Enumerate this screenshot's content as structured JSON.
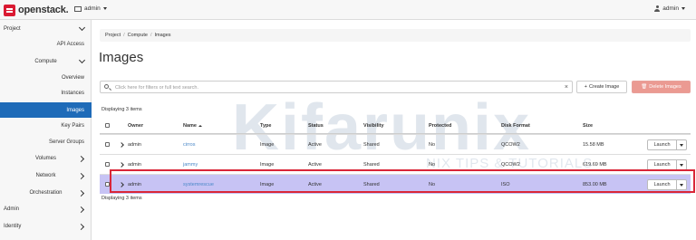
{
  "topbar": {
    "logo_text": "openstack.",
    "project_label": "admin",
    "user_label": "admin"
  },
  "sidebar": {
    "items": [
      {
        "label": "Project",
        "level": 0,
        "chevron": "down"
      },
      {
        "label": "API Access",
        "level": 2
      },
      {
        "label": "Compute",
        "level": 1,
        "chevron": "down"
      },
      {
        "label": "Overview",
        "level": 2
      },
      {
        "label": "Instances",
        "level": 2
      },
      {
        "label": "Images",
        "level": 2,
        "active": true
      },
      {
        "label": "Key Pairs",
        "level": 2
      },
      {
        "label": "Server Groups",
        "level": 2
      },
      {
        "label": "Volumes",
        "level": 1,
        "chevron": "right"
      },
      {
        "label": "Network",
        "level": 1,
        "chevron": "right"
      },
      {
        "label": "Orchestration",
        "level": 1,
        "chevron": "right"
      },
      {
        "label": "Admin",
        "level": 0,
        "chevron": "right"
      },
      {
        "label": "Identity",
        "level": 0,
        "chevron": "right"
      }
    ]
  },
  "breadcrumb": [
    "Project",
    "Compute",
    "Images"
  ],
  "page_title": "Images",
  "search": {
    "placeholder": "Click here for filters or full text search.",
    "value": "",
    "clear": "×"
  },
  "actions": {
    "create_label": "Create Image",
    "delete_label": "Delete Images"
  },
  "displaying_top": "Displaying 3 items",
  "displaying_bottom": "Displaying 3 items",
  "table": {
    "headers": {
      "owner": "Owner",
      "name": "Name",
      "type": "Type",
      "status": "Status",
      "visibility": "Visibility",
      "protected": "Protected",
      "disk_format": "Disk Format",
      "size": "Size"
    },
    "rows": [
      {
        "owner": "admin",
        "name": "cirros",
        "type": "Image",
        "status": "Active",
        "visibility": "Shared",
        "protected": "No",
        "disk_format": "QCOW2",
        "size": "15.58 MB",
        "action": "Launch",
        "selected": false
      },
      {
        "owner": "admin",
        "name": "jammy",
        "type": "Image",
        "status": "Active",
        "visibility": "Shared",
        "protected": "No",
        "disk_format": "QCOW2",
        "size": "619.69 MB",
        "action": "Launch",
        "selected": false
      },
      {
        "owner": "admin",
        "name": "systemrescue",
        "type": "Image",
        "status": "Active",
        "visibility": "Shared",
        "protected": "No",
        "disk_format": "ISO",
        "size": "853.00 MB",
        "action": "Launch",
        "selected": true
      }
    ]
  },
  "watermark": {
    "text": "Kifarunix",
    "subtext": "NIX TIPS & TUTORIALS"
  },
  "colors": {
    "accent": "#1e6bb8",
    "link": "#4a88c8",
    "danger": "#eb9a92",
    "selected_row": "#c7c3f4",
    "highlight_border": "#d92638"
  }
}
